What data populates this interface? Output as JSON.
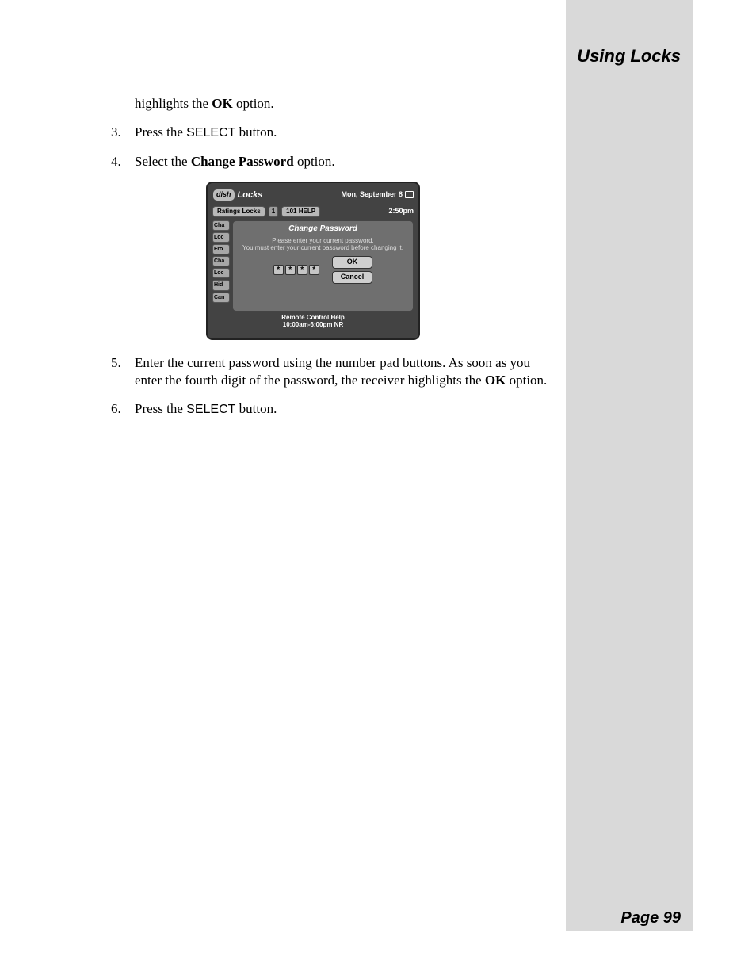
{
  "header": {
    "title": "Using Locks"
  },
  "footer": {
    "page": "Page 99"
  },
  "steps": {
    "frag_highlights": "highlights the ",
    "frag_ok": "OK",
    "frag_option": " option.",
    "n3": "3.",
    "s3_a": "Press the ",
    "s3_b": "SELECT",
    "s3_c": " button.",
    "n4": "4.",
    "s4_a": "Select the ",
    "s4_b": "Change Password",
    "s4_c": " option.",
    "n5": "5.",
    "s5_a": "Enter the current password using the number pad buttons. As soon as you enter the fourth digit of the password, the receiver highlights the ",
    "s5_b": "OK",
    "s5_c": " option.",
    "n6": "6.",
    "s6_a": "Press the ",
    "s6_b": "SELECT",
    "s6_c": " button."
  },
  "screen": {
    "brand": "dish",
    "title": "Locks",
    "date": "Mon, September 8",
    "tab_main": "Ratings Locks",
    "ch_num": "1",
    "ch_name": "101 HELP",
    "time": "2:50pm",
    "side_tabs": [
      "Cha",
      "Loc",
      "Fro",
      "Cha",
      "Loc",
      "Hid",
      "Can"
    ],
    "dialog_title": "Change Password",
    "dialog_msg1": "Please enter your current password.",
    "dialog_msg2": "You must enter your current password before changing it.",
    "pw_mask": "*",
    "ok": "OK",
    "cancel": "Cancel",
    "help1": "Remote Control Help",
    "help2": "10:00am-6:00pm NR"
  }
}
